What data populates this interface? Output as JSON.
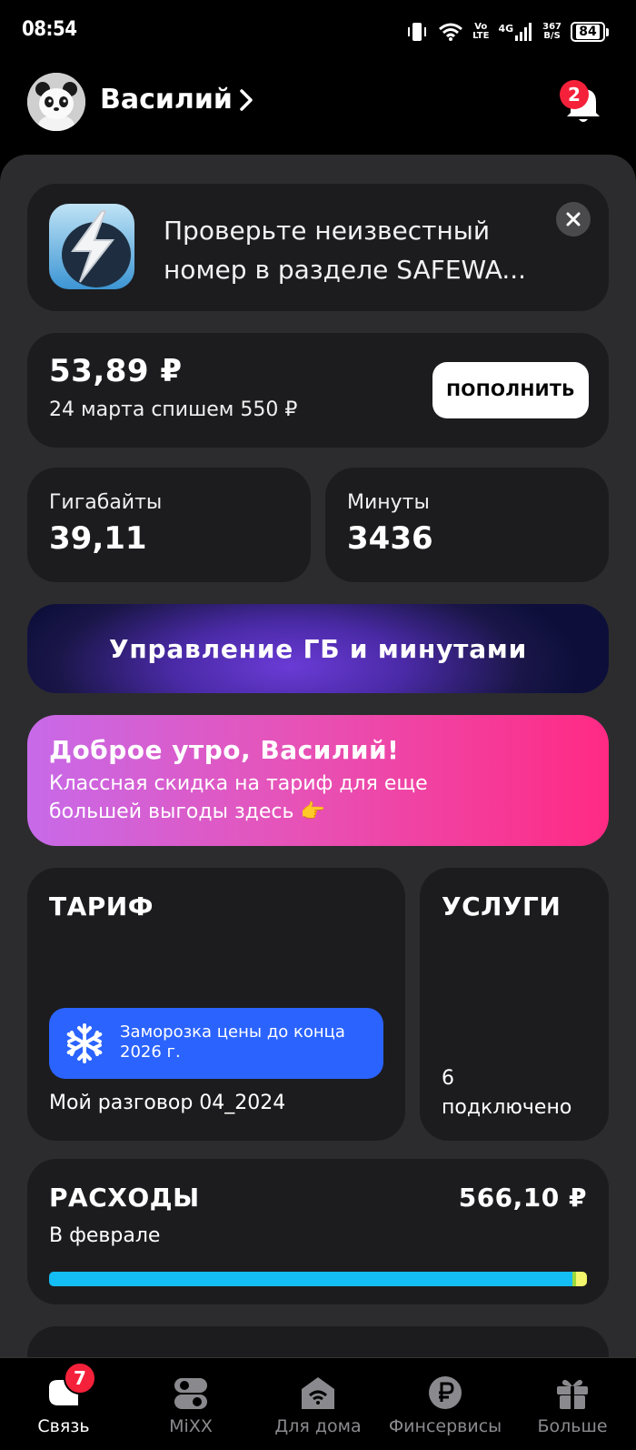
{
  "status_bar": {
    "time": "08:54",
    "volte_top": "Vo",
    "volte_bottom": "LTE",
    "network": "4G",
    "speed_top": "367",
    "speed_bottom": "B/S",
    "battery": "84"
  },
  "header": {
    "user_name": "Василий",
    "notifications_count": "2"
  },
  "promo": {
    "text": "Проверьте неизвестный номер в разделе SAFEWA..."
  },
  "balance": {
    "amount": "53,89 ₽",
    "next_charge": "24 марта спишем 550 ₽",
    "topup_label": "ПОПОЛНИТЬ"
  },
  "remaining": {
    "gb_label": "Гигабайты",
    "gb_value": "39,11",
    "min_label": "Минуты",
    "min_value": "3436"
  },
  "manage_button": "Управление ГБ и минутами",
  "greeting": {
    "title": "Доброе утро, Василий!",
    "text": "Классная скидка на тариф для еще большей выгоды здесь 👉"
  },
  "tariff": {
    "title": "ТАРИФ",
    "freeze_text": "Заморозка цены до конца 2026 г.",
    "name": "Мой разговор 04_2024"
  },
  "services": {
    "title": "УСЛУГИ",
    "count": "6",
    "count_label": "подключено"
  },
  "expenses": {
    "title": "РАСХОДЫ",
    "amount": "566,10 ₽",
    "period": "В феврале",
    "bar_segments": [
      0.973,
      0.006,
      0.021
    ],
    "colors": [
      "#14bdf4",
      "#9ad83a",
      "#f3f56a"
    ]
  },
  "bottom_nav": [
    {
      "label": "Связь",
      "icon": "chat-bubble-icon",
      "badge": "7",
      "active": true
    },
    {
      "label": "MiXX",
      "icon": "mixx-icon",
      "active": false
    },
    {
      "label": "Для дома",
      "icon": "home-wifi-icon",
      "active": false
    },
    {
      "label": "Финсервисы",
      "icon": "ruble-icon",
      "active": false
    },
    {
      "label": "Больше",
      "icon": "gift-icon",
      "active": false
    }
  ]
}
